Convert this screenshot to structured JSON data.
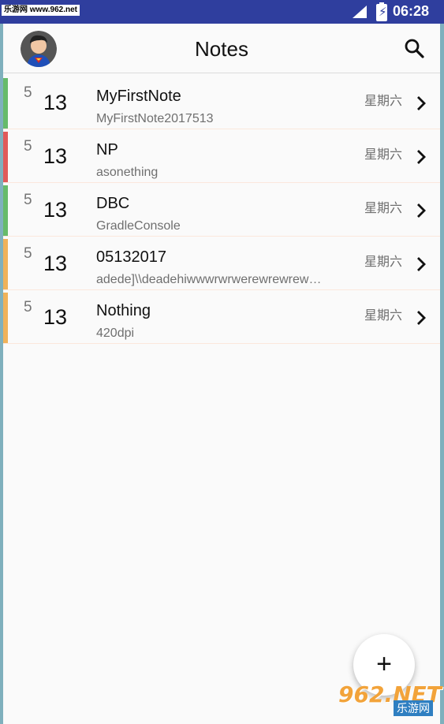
{
  "status_bar": {
    "watermark": "乐游网 www.962.net",
    "time": "06:28",
    "icons": [
      "signal-icon",
      "battery-charging-icon"
    ],
    "color": "#2f3e9e"
  },
  "toolbar": {
    "title": "Notes",
    "avatar_icon": "avatar-superman-icon",
    "search_icon": "search-icon"
  },
  "notes": [
    {
      "month": "5",
      "day": "13",
      "title": "MyFirstNote",
      "subtitle": "MyFirstNote2017513",
      "weekday": "星期六",
      "color": "#66bb6a"
    },
    {
      "month": "5",
      "day": "13",
      "title": "NP",
      "subtitle": "asonething",
      "weekday": "星期六",
      "color": "#e05a5a"
    },
    {
      "month": "5",
      "day": "13",
      "title": "DBC",
      "subtitle": "GradleConsole",
      "weekday": "星期六",
      "color": "#66bb6a"
    },
    {
      "month": "5",
      "day": "13",
      "title": "05132017",
      "subtitle": "adede]\\\\deadehiwwwrwrwerewrewrewrewrew",
      "weekday": "星期六",
      "color": "#f0b25a"
    },
    {
      "month": "5",
      "day": "13",
      "title": "Nothing",
      "subtitle": "420dpi",
      "weekday": "星期六",
      "color": "#f0b25a"
    }
  ],
  "fab": {
    "label": "+",
    "icon": "add-icon"
  },
  "watermark_bottom": {
    "big": "962.NET",
    "small": "乐游网"
  }
}
